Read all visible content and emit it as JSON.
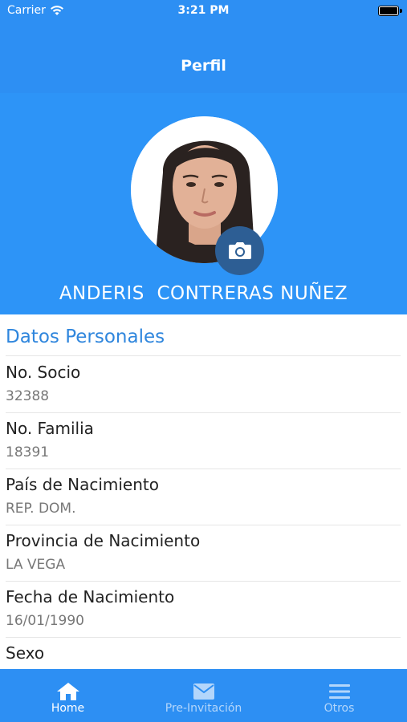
{
  "status_bar": {
    "carrier": "Carrier",
    "time": "3:21 PM"
  },
  "nav": {
    "title": "Perfil"
  },
  "profile": {
    "full_name": "ANDERIS  CONTRERAS NUÑEZ",
    "photo_icon": "person-photo",
    "camera_icon": "camera-icon"
  },
  "section": {
    "title": "Datos Personales"
  },
  "fields": [
    {
      "label": "No. Socio",
      "value": "32388"
    },
    {
      "label": "No. Familia",
      "value": "18391"
    },
    {
      "label": "País de Nacimiento",
      "value": "REP. DOM."
    },
    {
      "label": "Provincia de Nacimiento",
      "value": "LA VEGA"
    },
    {
      "label": "Fecha de Nacimiento",
      "value": "16/01/1990"
    },
    {
      "label": "Sexo",
      "value": ""
    }
  ],
  "tabs": [
    {
      "label": "Home",
      "icon": "home-icon",
      "active": true
    },
    {
      "label": "Pre-Invitación",
      "icon": "mail-icon",
      "active": false
    },
    {
      "label": "Otros",
      "icon": "menu-icon",
      "active": false
    }
  ],
  "colors": {
    "primary": "#2d8ff3",
    "header": "#2d94f7",
    "camera_button": "#2d5e94",
    "section_title": "#2f86dd"
  }
}
